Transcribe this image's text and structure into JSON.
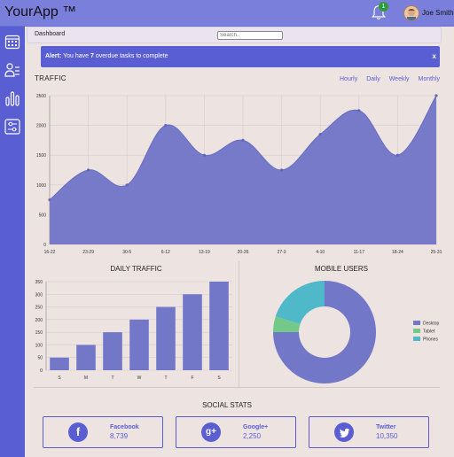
{
  "app": {
    "title": "YourApp ™",
    "user_name": "Joe Smith",
    "notification_count": "1"
  },
  "breadcrumb": "Dashboard",
  "search": {
    "placeholder": "Search.."
  },
  "alert": {
    "prefix": "Alert:",
    "pre": " You have ",
    "count": "7",
    "post": " overdue tasks to complete",
    "close": "x"
  },
  "traffic": {
    "title": "TRAFFIC",
    "tabs": [
      "Hourly",
      "Daily",
      "Weekly",
      "Monthly"
    ]
  },
  "daily_traffic_title": "DAILY TRAFFIC",
  "mobile_users_title": "MOBILE USERS",
  "social": {
    "title": "SOCIAL STATS",
    "items": [
      {
        "name": "Facebook",
        "value": "8,739",
        "icon": "facebook-icon"
      },
      {
        "name": "Google+",
        "value": "2,250",
        "icon": "google-plus-icon"
      },
      {
        "name": "Twitter",
        "value": "10,350",
        "icon": "twitter-icon"
      }
    ]
  },
  "colors": {
    "accent": "#7377c8",
    "sidebar": "#5a5ed3",
    "green": "#72c98a",
    "cyan": "#4fb8c9"
  },
  "chart_data": [
    {
      "type": "area",
      "x": [
        "16-22",
        "23-29",
        "30-5",
        "6-12",
        "13-19",
        "20-26",
        "27-3",
        "4-10",
        "11-17",
        "18-24",
        "25-31"
      ],
      "values": [
        750,
        1250,
        1000,
        2000,
        1500,
        1750,
        1250,
        1850,
        2250,
        1500,
        2500
      ],
      "ylim": [
        0,
        2500
      ],
      "yticks": [
        0,
        500,
        1000,
        1500,
        2000,
        2500
      ],
      "grid": true
    },
    {
      "type": "bar",
      "title": "DAILY TRAFFIC",
      "categories": [
        "S",
        "M",
        "T",
        "W",
        "T",
        "F",
        "S"
      ],
      "values": [
        50,
        100,
        150,
        200,
        250,
        300,
        350
      ],
      "ylim": [
        0,
        350
      ],
      "yticks": [
        0,
        50,
        100,
        150,
        200,
        250,
        300,
        350
      ]
    },
    {
      "type": "pie",
      "title": "MOBILE USERS",
      "labels": [
        "Desktop",
        "Tablet",
        "Phones"
      ],
      "values": [
        75,
        5,
        20
      ],
      "colors": [
        "#7377c8",
        "#72c98a",
        "#4fb8c9"
      ],
      "legend": "right"
    }
  ]
}
